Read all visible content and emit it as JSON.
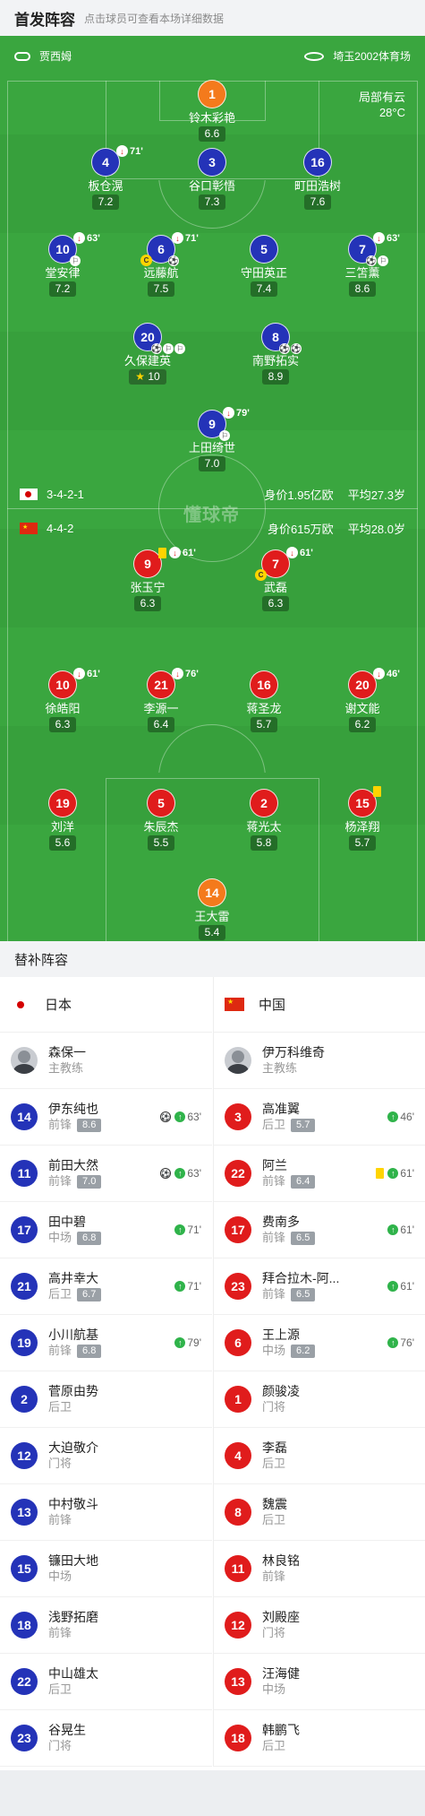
{
  "header": {
    "title": "首发阵容",
    "hint": "点击球员可查看本场详细数据"
  },
  "pitch": {
    "referee": "贾西姆",
    "stadium": "埼玉2002体育场",
    "weather": "局部有云",
    "temperature": "28°C",
    "watermark": "懂球帝"
  },
  "japan": {
    "formation": "3-4-2-1",
    "value": "身价1.95亿欧",
    "age": "平均27.3岁",
    "players": [
      {
        "num": "1",
        "name": "铃木彩艳",
        "rating": "6.6",
        "gk": true
      },
      {
        "num": "4",
        "name": "板仓滉",
        "rating": "7.2",
        "sub": "71'"
      },
      {
        "num": "3",
        "name": "谷口彰悟",
        "rating": "7.3"
      },
      {
        "num": "16",
        "name": "町田浩树",
        "rating": "7.6"
      },
      {
        "num": "10",
        "name": "堂安律",
        "rating": "7.2",
        "sub": "63'",
        "assist": 1
      },
      {
        "num": "6",
        "name": "远藤航",
        "rating": "7.5",
        "sub": "71'",
        "goal": 1,
        "captain": true
      },
      {
        "num": "5",
        "name": "守田英正",
        "rating": "7.4"
      },
      {
        "num": "7",
        "name": "三笘薰",
        "rating": "8.6",
        "sub": "63'",
        "goal": 1,
        "assist": 1
      },
      {
        "num": "20",
        "name": "久保建英",
        "rating": "10",
        "goal": 1,
        "assist": 2,
        "best": true
      },
      {
        "num": "8",
        "name": "南野拓实",
        "rating": "8.9",
        "goal": 2
      },
      {
        "num": "9",
        "name": "上田绮世",
        "rating": "7.0",
        "sub": "79'",
        "assist": 1
      }
    ]
  },
  "china": {
    "formation": "4-4-2",
    "value": "身价615万欧",
    "age": "平均28.0岁",
    "players": [
      {
        "num": "9",
        "name": "张玉宁",
        "rating": "6.3",
        "sub": "61'",
        "yellow": true
      },
      {
        "num": "7",
        "name": "武磊",
        "rating": "6.3",
        "sub": "61'",
        "captain": true
      },
      {
        "num": "10",
        "name": "徐皓阳",
        "rating": "6.3",
        "sub": "61'"
      },
      {
        "num": "21",
        "name": "李源一",
        "rating": "6.4",
        "sub": "76'"
      },
      {
        "num": "16",
        "name": "蒋圣龙",
        "rating": "5.7"
      },
      {
        "num": "20",
        "name": "谢文能",
        "rating": "6.2",
        "sub": "46'"
      },
      {
        "num": "19",
        "name": "刘洋",
        "rating": "5.6"
      },
      {
        "num": "5",
        "name": "朱辰杰",
        "rating": "5.5"
      },
      {
        "num": "2",
        "name": "蒋光太",
        "rating": "5.8"
      },
      {
        "num": "15",
        "name": "杨泽翔",
        "rating": "5.7",
        "yellowOnly": true
      },
      {
        "num": "14",
        "name": "王大雷",
        "rating": "5.4",
        "gk": true
      }
    ]
  },
  "subs_title": "替补阵容",
  "subs": {
    "japan_name": "日本",
    "china_name": "中国",
    "japan_coach": {
      "name": "森保一",
      "role": "主教练"
    },
    "china_coach": {
      "name": "伊万科维奇",
      "role": "主教练"
    },
    "japan": [
      {
        "num": "14",
        "name": "伊东纯也",
        "pos": "前锋",
        "rating": "8.6",
        "goal": true,
        "minute": "63'"
      },
      {
        "num": "11",
        "name": "前田大然",
        "pos": "前锋",
        "rating": "7.0",
        "goal": true,
        "minute": "63'"
      },
      {
        "num": "17",
        "name": "田中碧",
        "pos": "中场",
        "rating": "6.8",
        "minute": "71'"
      },
      {
        "num": "21",
        "name": "高井幸大",
        "pos": "后卫",
        "rating": "6.7",
        "minute": "71'"
      },
      {
        "num": "19",
        "name": "小川航基",
        "pos": "前锋",
        "rating": "6.8",
        "minute": "79'"
      },
      {
        "num": "2",
        "name": "菅原由势",
        "pos": "后卫"
      },
      {
        "num": "12",
        "name": "大迫敬介",
        "pos": "门将"
      },
      {
        "num": "13",
        "name": "中村敬斗",
        "pos": "前锋"
      },
      {
        "num": "15",
        "name": "镰田大地",
        "pos": "中场"
      },
      {
        "num": "18",
        "name": "浅野拓磨",
        "pos": "前锋"
      },
      {
        "num": "22",
        "name": "中山雄太",
        "pos": "后卫"
      },
      {
        "num": "23",
        "name": "谷晃生",
        "pos": "门将"
      }
    ],
    "china": [
      {
        "num": "3",
        "name": "高准翼",
        "pos": "后卫",
        "rating": "5.7",
        "minute": "46'"
      },
      {
        "num": "22",
        "name": "阿兰",
        "pos": "前锋",
        "rating": "6.4",
        "yellow": true,
        "minute": "61'"
      },
      {
        "num": "17",
        "name": "费南多",
        "pos": "前锋",
        "rating": "6.5",
        "minute": "61'"
      },
      {
        "num": "23",
        "name": "拜合拉木-阿...",
        "pos": "前锋",
        "rating": "6.5",
        "minute": "61'"
      },
      {
        "num": "6",
        "name": "王上源",
        "pos": "中场",
        "rating": "6.2",
        "minute": "76'"
      },
      {
        "num": "1",
        "name": "颜骏凌",
        "pos": "门将"
      },
      {
        "num": "4",
        "name": "李磊",
        "pos": "后卫"
      },
      {
        "num": "8",
        "name": "魏震",
        "pos": "后卫"
      },
      {
        "num": "11",
        "name": "林良铭",
        "pos": "前锋"
      },
      {
        "num": "12",
        "name": "刘殿座",
        "pos": "门将"
      },
      {
        "num": "13",
        "name": "汪海健",
        "pos": "中场"
      },
      {
        "num": "18",
        "name": "韩鹏飞",
        "pos": "后卫"
      }
    ]
  },
  "colors": {
    "japan": "#2433b8",
    "china": "#e01c1c",
    "gk": "#f47a1c",
    "pitch": "#3aa63f"
  }
}
